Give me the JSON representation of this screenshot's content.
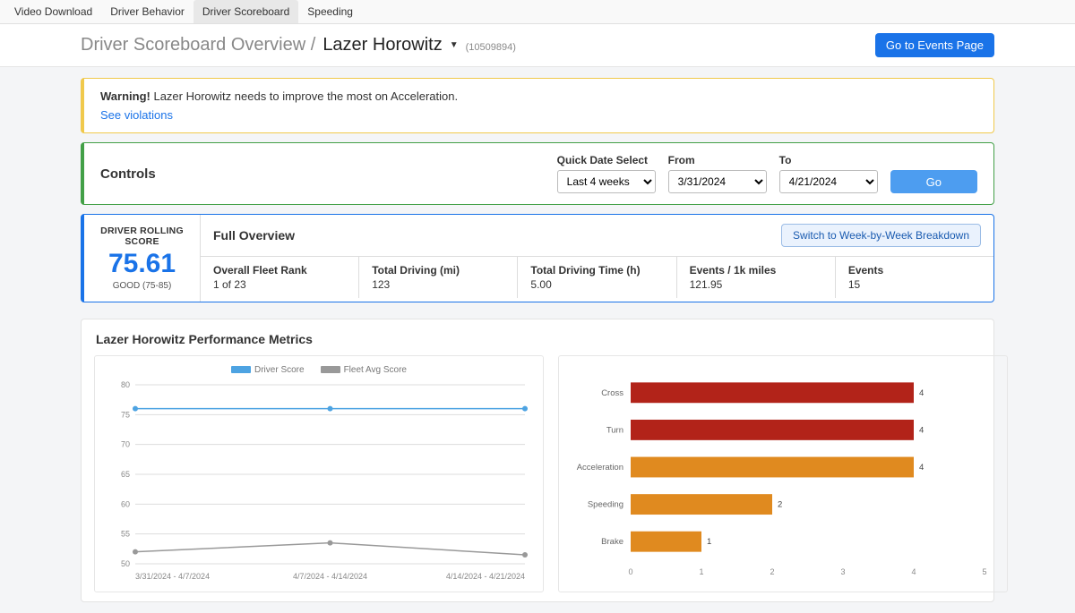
{
  "nav": {
    "tabs": [
      "Video Download",
      "Driver Behavior",
      "Driver Scoreboard",
      "Speeding"
    ],
    "active": 2
  },
  "header": {
    "crumb": "Driver Scoreboard Overview  /",
    "driver_name": "Lazer Horowitz",
    "driver_id": "(10509894)",
    "events_btn": "Go to Events Page"
  },
  "alert": {
    "prefix": "Warning!",
    "text": "Lazer Horowitz needs to improve the most on Acceleration.",
    "link": "See violations"
  },
  "controls": {
    "title": "Controls",
    "quick_label": "Quick Date Select",
    "quick_value": "Last 4 weeks",
    "from_label": "From",
    "from_value": "3/31/2024",
    "to_label": "To",
    "to_value": "4/21/2024",
    "go": "Go"
  },
  "score": {
    "label": "DRIVER ROLLING SCORE",
    "value": "75.61",
    "band": "GOOD (75-85)",
    "overview": "Full Overview",
    "switch": "Switch to Week-by-Week Breakdown",
    "stats": [
      {
        "k": "Overall Fleet Rank",
        "v": "1 of 23"
      },
      {
        "k": "Total Driving (mi)",
        "v": "123"
      },
      {
        "k": "Total Driving Time (h)",
        "v": "5.00"
      },
      {
        "k": "Events / 1k miles",
        "v": "121.95"
      },
      {
        "k": "Events",
        "v": "15"
      }
    ]
  },
  "metrics": {
    "title": "Lazer Horowitz Performance Metrics"
  },
  "chart_data": [
    {
      "type": "line",
      "title": "",
      "xlabel": "",
      "ylabel": "",
      "ylim": [
        50,
        80
      ],
      "yticks": [
        50,
        55,
        60,
        65,
        70,
        75,
        80
      ],
      "categories": [
        "3/31/2024 - 4/7/2024",
        "4/7/2024 - 4/14/2024",
        "4/14/2024 - 4/21/2024"
      ],
      "series": [
        {
          "name": "Driver Score",
          "color": "#4da3e2",
          "values": [
            76,
            76,
            76
          ]
        },
        {
          "name": "Fleet Avg Score",
          "color": "#999999",
          "values": [
            52,
            53.5,
            51.5
          ]
        }
      ]
    },
    {
      "type": "bar",
      "orientation": "horizontal",
      "xlim": [
        0,
        5
      ],
      "xticks": [
        0,
        1,
        2,
        3,
        4,
        5
      ],
      "categories": [
        "Cross",
        "Turn",
        "Acceleration",
        "Speeding",
        "Brake"
      ],
      "values": [
        4,
        4,
        4,
        2,
        1
      ],
      "colors": [
        "#b22319",
        "#b22319",
        "#e08a1f",
        "#e08a1f",
        "#e08a1f"
      ]
    }
  ]
}
